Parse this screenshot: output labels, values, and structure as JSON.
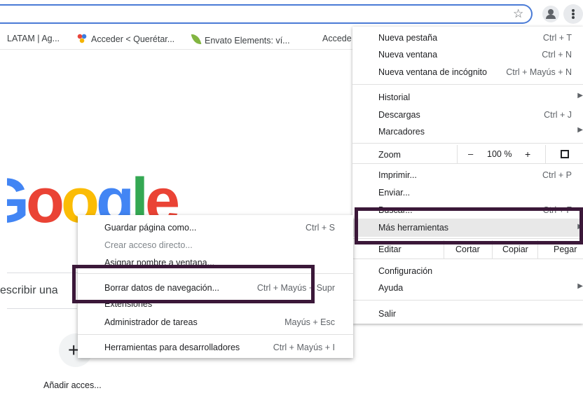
{
  "toolbar": {
    "star_icon": "☆"
  },
  "bookmarks": [
    {
      "label": "LATAM | Ag..."
    },
    {
      "label": "Acceder < Querétar..."
    },
    {
      "label": "Envato Elements: ví..."
    },
    {
      "label": "Accede"
    }
  ],
  "newtab": {
    "logo_letters": [
      "G",
      "o",
      "o",
      "g",
      "l",
      "e"
    ],
    "search_placeholder": "escribir una",
    "add_shortcut_label": "Añadir acces...",
    "add_shortcut_plus": "+"
  },
  "menu": {
    "new_tab": {
      "label": "Nueva pestaña",
      "shortcut": "Ctrl + T"
    },
    "new_window": {
      "label": "Nueva ventana",
      "shortcut": "Ctrl + N"
    },
    "incognito": {
      "label": "Nueva ventana de incógnito",
      "shortcut": "Ctrl + Mayús + N"
    },
    "history": {
      "label": "Historial"
    },
    "downloads": {
      "label": "Descargas",
      "shortcut": "Ctrl + J"
    },
    "bookmarks": {
      "label": "Marcadores"
    },
    "zoom": {
      "label": "Zoom",
      "minus": "–",
      "value": "100 %",
      "plus": "+"
    },
    "print": {
      "label": "Imprimir...",
      "shortcut": "Ctrl + P"
    },
    "cast": {
      "label": "Enviar..."
    },
    "find": {
      "label": "Buscar...",
      "shortcut": "Ctrl + F"
    },
    "more_tools": {
      "label": "Más herramientas"
    },
    "edit": {
      "label": "Editar",
      "cut": "Cortar",
      "copy": "Copiar",
      "paste": "Pegar"
    },
    "settings": {
      "label": "Configuración"
    },
    "help": {
      "label": "Ayuda"
    },
    "exit": {
      "label": "Salir"
    }
  },
  "submenu": {
    "save_page": {
      "label": "Guardar página como...",
      "shortcut": "Ctrl + S"
    },
    "create_shortcut": {
      "label": "Crear acceso directo..."
    },
    "name_window": {
      "label": "Asignar nombre a ventana..."
    },
    "clear_data": {
      "label": "Borrar datos de navegación...",
      "shortcut": "Ctrl + Mayús + Supr"
    },
    "extensions": {
      "label": "Extensiones"
    },
    "task_manager": {
      "label": "Administrador de tareas",
      "shortcut": "Mayús + Esc"
    },
    "dev_tools": {
      "label": "Herramientas para desarrolladores",
      "shortcut": "Ctrl + Mayús + I"
    }
  },
  "colors": {
    "annotation": "#3b1839",
    "address_border": "#4a7bd6",
    "highlight": "#e8e8e8"
  }
}
